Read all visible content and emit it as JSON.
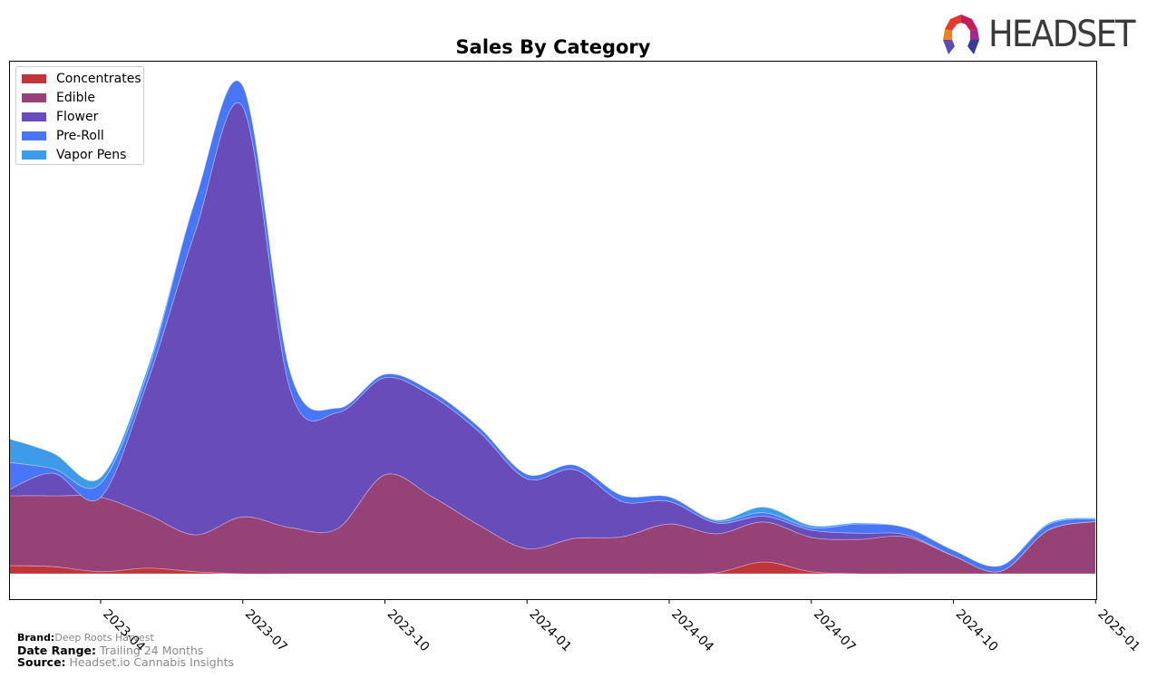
{
  "header": {
    "logo_text": "HEADSET"
  },
  "chart_data": {
    "type": "area",
    "stacked": true,
    "smooth": true,
    "title": "Sales By Category",
    "xlabel": "",
    "ylabel": "",
    "y_units": "relative sales (axis unlabeled)",
    "ylim": [
      0,
      100
    ],
    "grid": false,
    "legend_position": "top-left",
    "x": [
      "2023-02",
      "2023-03",
      "2023-04",
      "2023-05",
      "2023-06",
      "2023-07",
      "2023-08",
      "2023-09",
      "2023-10",
      "2023-11",
      "2023-12",
      "2024-01",
      "2024-02",
      "2024-03",
      "2024-04",
      "2024-05",
      "2024-06",
      "2024-07",
      "2024-08",
      "2024-09",
      "2024-10",
      "2024-11",
      "2024-12",
      "2025-01"
    ],
    "xticks": [
      "2023-04",
      "2023-07",
      "2023-10",
      "2024-01",
      "2024-04",
      "2024-07",
      "2024-10",
      "2025-01"
    ],
    "series": [
      {
        "name": "Concentrates",
        "color": "#c0353a",
        "values": [
          1.6,
          1.4,
          0.4,
          1.1,
          0.4,
          0.0,
          0.0,
          0.0,
          0.0,
          0.0,
          0.0,
          0.0,
          0.0,
          0.0,
          0.0,
          0.2,
          2.3,
          0.4,
          0.0,
          0.0,
          0.0,
          0.0,
          0.0,
          0.0
        ]
      },
      {
        "name": "Edible",
        "color": "#974276",
        "values": [
          13.6,
          13.8,
          14.5,
          10.4,
          7.2,
          11.1,
          9.0,
          8.8,
          19.3,
          15.0,
          9.4,
          4.9,
          6.9,
          7.2,
          9.7,
          7.6,
          7.8,
          6.7,
          6.7,
          7.2,
          3.5,
          0.5,
          8.5,
          10.2
        ]
      },
      {
        "name": "Flower",
        "color": "#684dba",
        "values": [
          1.2,
          4.4,
          0.0,
          26.2,
          59.2,
          79.9,
          26.9,
          22.6,
          18.9,
          19.6,
          18.2,
          13.6,
          13.4,
          6.9,
          4.4,
          2.1,
          1.1,
          1.4,
          1.2,
          0.4,
          0.0,
          0.0,
          0.0,
          0.0
        ]
      },
      {
        "name": "Pre-Roll",
        "color": "#4876f7",
        "values": [
          5.3,
          0.9,
          2.7,
          1.8,
          6.2,
          4.1,
          3.5,
          0.9,
          0.7,
          0.9,
          0.9,
          0.9,
          0.9,
          1.2,
          0.9,
          0.4,
          0.7,
          0.5,
          1.8,
          1.4,
          1.1,
          1.1,
          1.1,
          0.5
        ]
      },
      {
        "name": "Vapor Pens",
        "color": "#3d9be9",
        "values": [
          4.6,
          3.0,
          1.2,
          0.9,
          0.0,
          0.0,
          0.0,
          0.0,
          0.0,
          0.0,
          0.0,
          0.0,
          0.0,
          0.0,
          0.0,
          0.2,
          1.1,
          0.4,
          0.2,
          0.0,
          0.0,
          0.0,
          0.2,
          0.2
        ]
      }
    ]
  },
  "footer": {
    "brand_label": "Brand:",
    "brand_value": "Deep Roots Harvest",
    "date_range_label": "Date Range:",
    "date_range_value": "Trailing 24 Months",
    "source_label": "Source:",
    "source_value": "Headset.io Cannabis Insights"
  }
}
